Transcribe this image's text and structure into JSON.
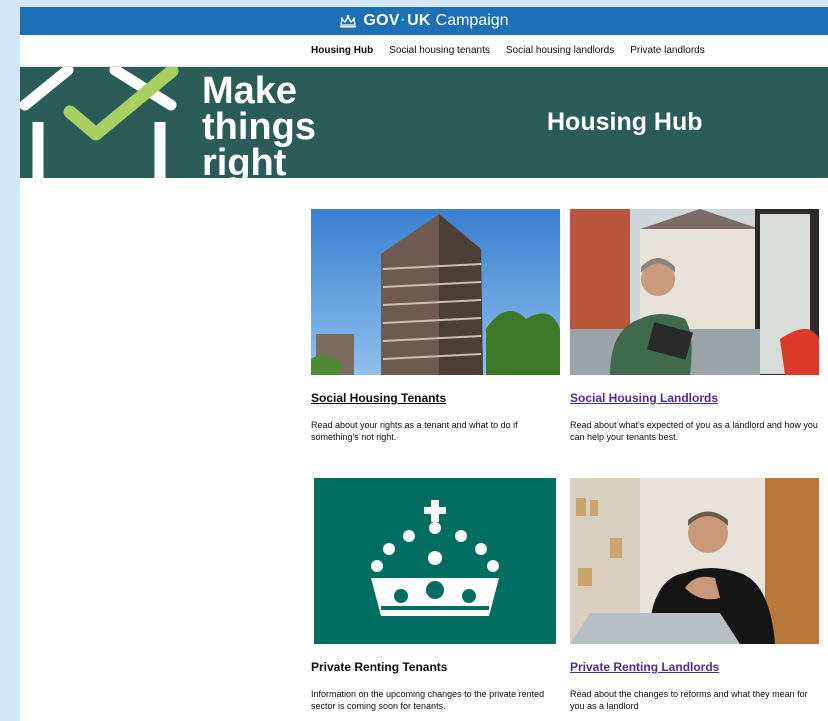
{
  "header": {
    "brand_prefix": "GOV",
    "brand_dot": "·",
    "brand_suffix": "UK",
    "campaign": "Campaign"
  },
  "nav": {
    "items": [
      {
        "label": "Housing Hub"
      },
      {
        "label": "Social housing tenants"
      },
      {
        "label": "Social housing landlords"
      },
      {
        "label": "Private landlords"
      }
    ]
  },
  "hero": {
    "slogan_line1": "Make",
    "slogan_line2": "things",
    "slogan_line3": "right",
    "title": "Housing Hub"
  },
  "cards": [
    {
      "title": "Social Housing Tenants",
      "description": "Read about your rights as a tenant and what to do if something's not right."
    },
    {
      "title": "Social Housing Landlords",
      "description": "Read about what's expected of you as a landlord and how you can help your tenants best."
    },
    {
      "title": "Private Renting Tenants",
      "description": "Information on the upcoming changes to the private rented sector is coming soon for tenants."
    },
    {
      "title": "Private Renting Landlords",
      "description": "Read about the changes to reforms and what they mean for you as a landlord"
    }
  ],
  "colors": {
    "govuk_blue": "#1d70b8",
    "hero_green": "#2b5c57",
    "check_green": "#a8cf61",
    "crown_teal": "#006d61",
    "link_purple": "#4c2c92",
    "page_bg": "#d2e6f5"
  },
  "icons": {
    "crown": "crown-icon",
    "logo": "house-check-logo"
  }
}
